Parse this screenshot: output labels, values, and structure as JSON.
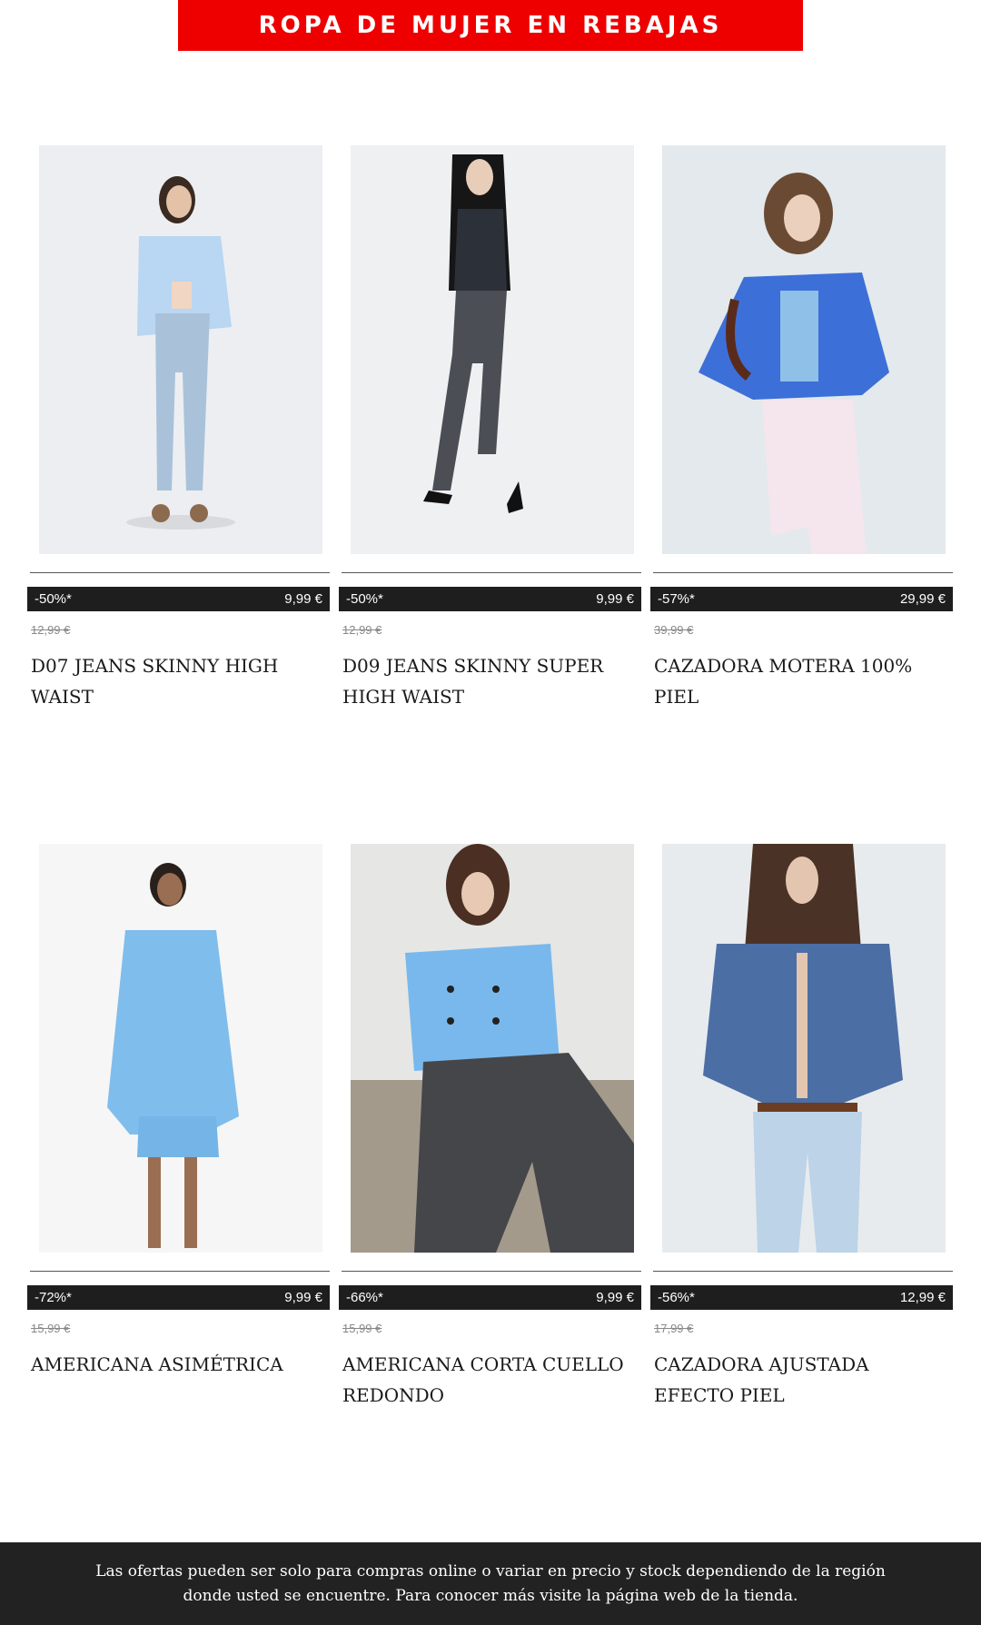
{
  "banner": {
    "title": "ROPA DE MUJER EN REBAJAS",
    "color": "#ee0000"
  },
  "products": [
    {
      "discount": "-50%*",
      "price": "9,99 €",
      "old_price": "12,99 €",
      "name": "D07 JEANS SKINNY HIGH WAIST",
      "image": "woman-light-blue-shirt-skinny-jeans"
    },
    {
      "discount": "-50%*",
      "price": "9,99 €",
      "old_price": "12,99 €",
      "name": "D09 JEANS SKINNY SUPER HIGH WAIST",
      "image": "woman-black-top-grey-skinny-jeans"
    },
    {
      "discount": "-57%*",
      "price": "29,99 €",
      "old_price": "39,99 €",
      "name": "CAZADORA MOTERA 100% PIEL",
      "image": "woman-blue-leather-jacket"
    },
    {
      "discount": "-72%*",
      "price": "9,99 €",
      "old_price": "15,99 €",
      "name": "AMERICANA ASIMÉTRICA",
      "image": "woman-light-blue-blazer-skirt"
    },
    {
      "discount": "-66%*",
      "price": "9,99 €",
      "old_price": "15,99 €",
      "name": "AMERICANA CORTA CUELLO REDONDO",
      "image": "woman-blue-cropped-jacket-seated"
    },
    {
      "discount": "-56%*",
      "price": "12,99 €",
      "old_price": "17,99 €",
      "name": "CAZADORA AJUSTADA EFECTO PIEL",
      "image": "woman-blue-faux-leather-jacket"
    }
  ],
  "footer": {
    "text": "Las ofertas pueden ser solo para compras online o variar en precio y stock dependiendo de la región donde usted se encuentre. Para conocer más visite la página web de la tienda."
  }
}
